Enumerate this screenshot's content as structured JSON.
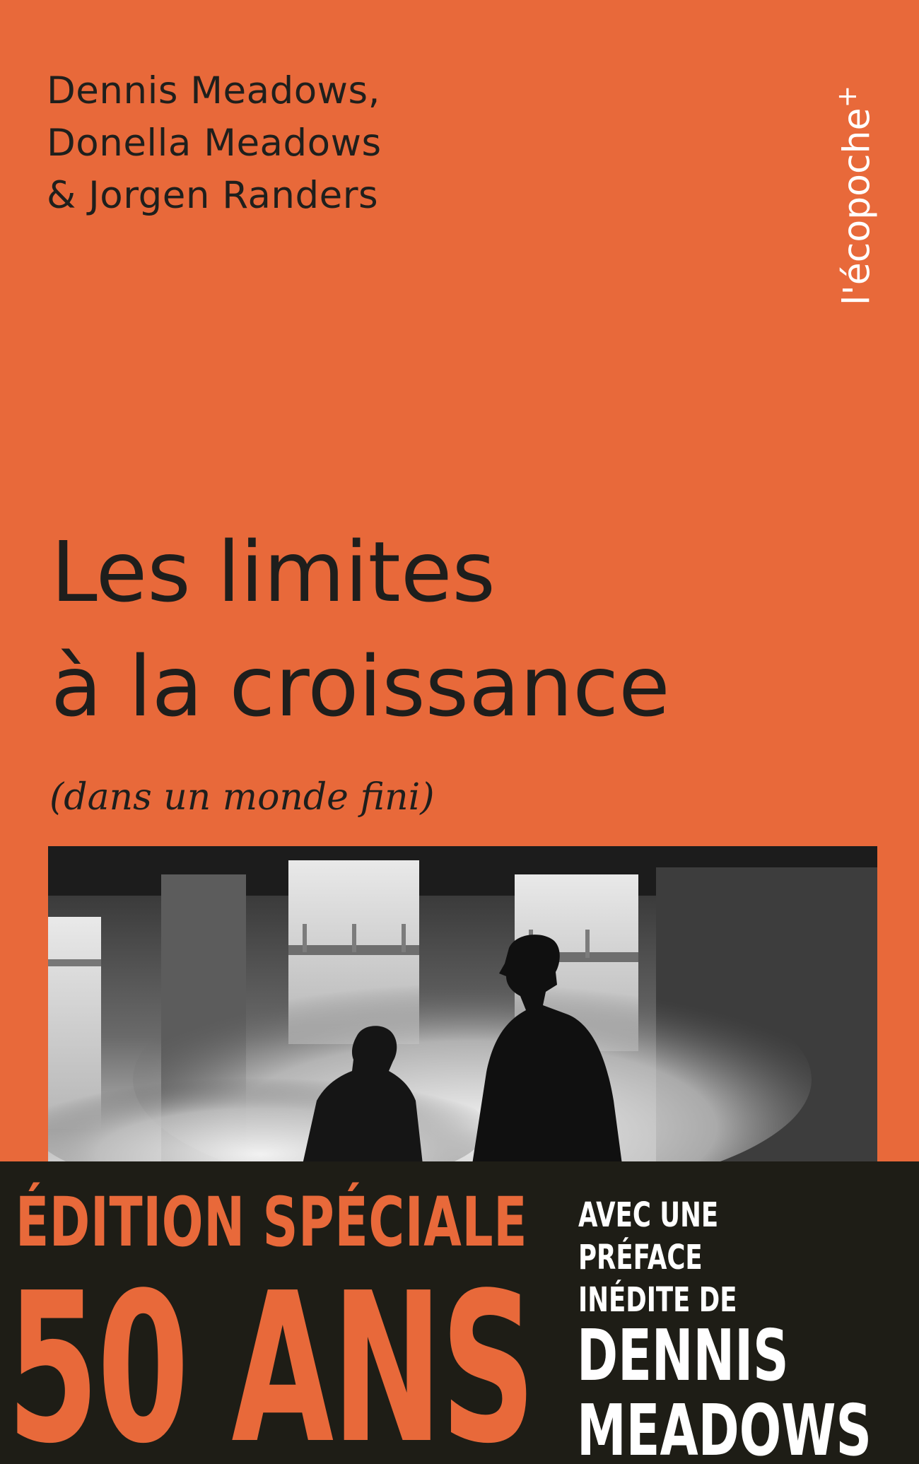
{
  "authors": [
    "Dennis Meadows,",
    "Donella Meadows",
    "& Jorgen Randers"
  ],
  "publisher": {
    "name": "l'écopoche",
    "mark": "+"
  },
  "title": {
    "line1": "Les limites",
    "line2": "à la croissance"
  },
  "subtitle": "(dans un monde fini)",
  "photo": {
    "alt": "Photographie en noir et blanc : silhouettes de deux hommes dans une salle enfumée, un pont visible à travers les fenêtres"
  },
  "band": {
    "edition": "ÉDITION SPÉCIALE",
    "years": "50 ANS",
    "preface_lines": [
      "AVEC UNE",
      "PRÉFACE",
      "INÉDITE DE"
    ],
    "guest_lines": [
      "DENNIS",
      "MEADOWS"
    ]
  },
  "colors": {
    "background": "#E8693A",
    "band": "#1E1D16",
    "text": "#1E1E1C",
    "white": "#FFFFFF"
  }
}
